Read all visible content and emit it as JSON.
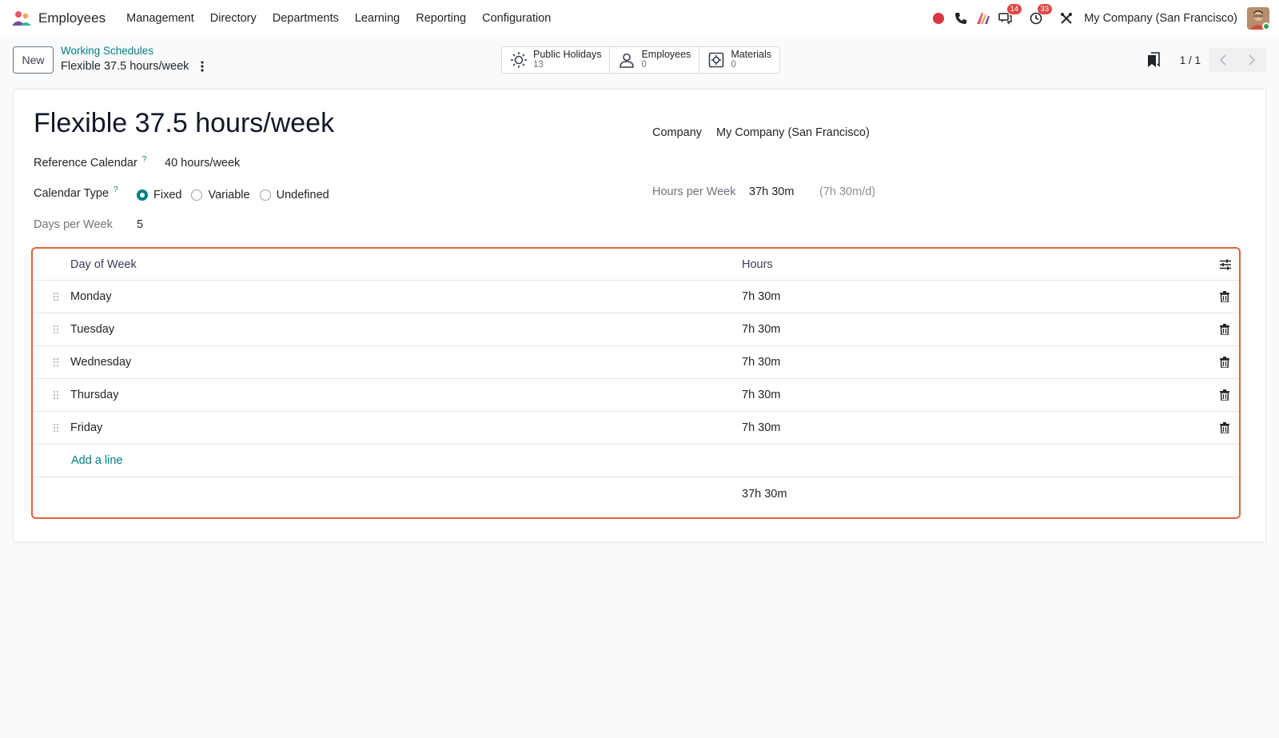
{
  "navbar": {
    "app_name": "Employees",
    "menu": [
      "Management",
      "Directory",
      "Departments",
      "Learning",
      "Reporting",
      "Configuration"
    ],
    "messages_badge": "14",
    "activities_badge": "33",
    "company": "My Company (San Francisco)"
  },
  "control": {
    "new_label": "New",
    "breadcrumb_parent": "Working Schedules",
    "breadcrumb_current": "Flexible 37.5 hours/week",
    "smart_buttons": [
      {
        "label": "Public Holidays",
        "value": "13"
      },
      {
        "label": "Employees",
        "value": "0"
      },
      {
        "label": "Materials",
        "value": "0"
      }
    ],
    "pager": "1 / 1"
  },
  "form": {
    "title": "Flexible 37.5 hours/week",
    "reference_calendar_label": "Reference Calendar",
    "reference_calendar_value": "40 hours/week",
    "calendar_type_label": "Calendar Type",
    "calendar_type_options": [
      "Fixed",
      "Variable",
      "Undefined"
    ],
    "calendar_type_selected": "Fixed",
    "days_per_week_label": "Days per Week",
    "days_per_week_value": "5",
    "company_label": "Company",
    "company_value": "My Company (San Francisco)",
    "hours_per_week_label": "Hours per Week",
    "hours_per_week_value": "37h 30m",
    "hours_per_day_value": "(7h 30m/d)"
  },
  "table": {
    "headers": {
      "day": "Day of Week",
      "hours": "Hours"
    },
    "rows": [
      {
        "day": "Monday",
        "hours": "7h 30m"
      },
      {
        "day": "Tuesday",
        "hours": "7h 30m"
      },
      {
        "day": "Wednesday",
        "hours": "7h 30m"
      },
      {
        "day": "Thursday",
        "hours": "7h 30m"
      },
      {
        "day": "Friday",
        "hours": "7h 30m"
      }
    ],
    "add_line": "Add a line",
    "total": "37h 30m"
  },
  "colors": {
    "accent": "#017e84",
    "highlight_border": "#e0633a",
    "badge": "#e04848"
  }
}
